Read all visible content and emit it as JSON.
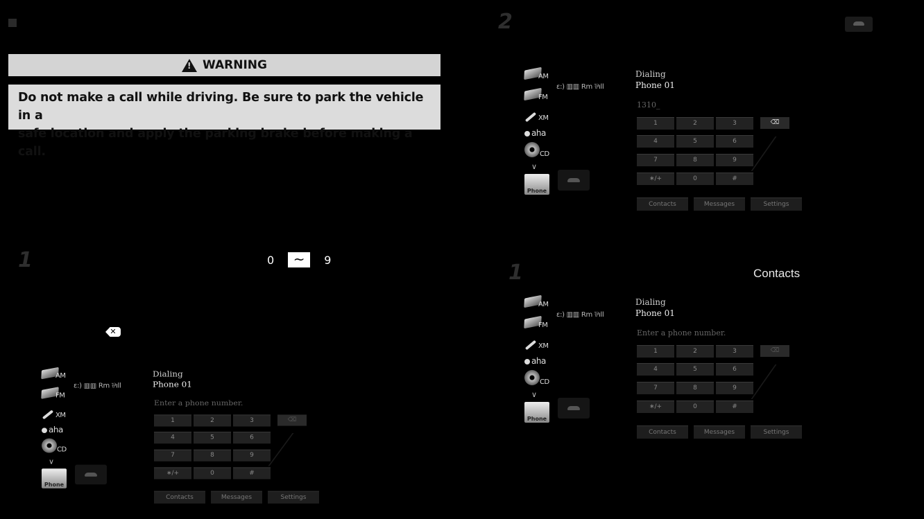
{
  "warning": {
    "title": "WARNING",
    "line1": "Do not make a call while driving. Be sure to park the vehicle in a",
    "line2": "safe location and apply the parking brake before making a call."
  },
  "steps": {
    "s1a": "1",
    "s2": "2",
    "s1b": "1"
  },
  "range": {
    "from": "0",
    "sep": "~",
    "to": "9"
  },
  "contacts_label": "Contacts",
  "screens": [
    {
      "sources": [
        "AM",
        "FM",
        "XM",
        "aha",
        "CD",
        "∨",
        "Phone"
      ],
      "status": "ε:) ▥▥ Rm ⅌ıll",
      "dialing": "Dialing",
      "phone": "Phone 01",
      "number": "Enter a phone number.",
      "backspace_active": false,
      "keys": [
        "1",
        "2",
        "3",
        "4",
        "5",
        "6",
        "7",
        "8",
        "9",
        "∗/+",
        "0",
        "#"
      ],
      "softkeys": [
        "Contacts",
        "Messages",
        "Settings"
      ]
    },
    {
      "sources": [
        "AM",
        "FM",
        "XM",
        "aha",
        "CD",
        "∨",
        "Phone"
      ],
      "status": "ε:) ▥▥ Rm ⅌ıll",
      "dialing": "Dialing",
      "phone": "Phone 01",
      "number": "1310_",
      "backspace_active": true,
      "keys": [
        "1",
        "2",
        "3",
        "4",
        "5",
        "6",
        "7",
        "8",
        "9",
        "∗/+",
        "0",
        "#"
      ],
      "softkeys": [
        "Contacts",
        "Messages",
        "Settings"
      ]
    },
    {
      "sources": [
        "AM",
        "FM",
        "XM",
        "aha",
        "CD",
        "∨",
        "Phone"
      ],
      "status": "ε:) ▥▥ Rm ⅌ıll",
      "dialing": "Dialing",
      "phone": "Phone 01",
      "number": "Enter a phone number.",
      "backspace_active": false,
      "keys": [
        "1",
        "2",
        "3",
        "4",
        "5",
        "6",
        "7",
        "8",
        "9",
        "∗/+",
        "0",
        "#"
      ],
      "softkeys": [
        "Contacts",
        "Messages",
        "Settings"
      ]
    }
  ]
}
